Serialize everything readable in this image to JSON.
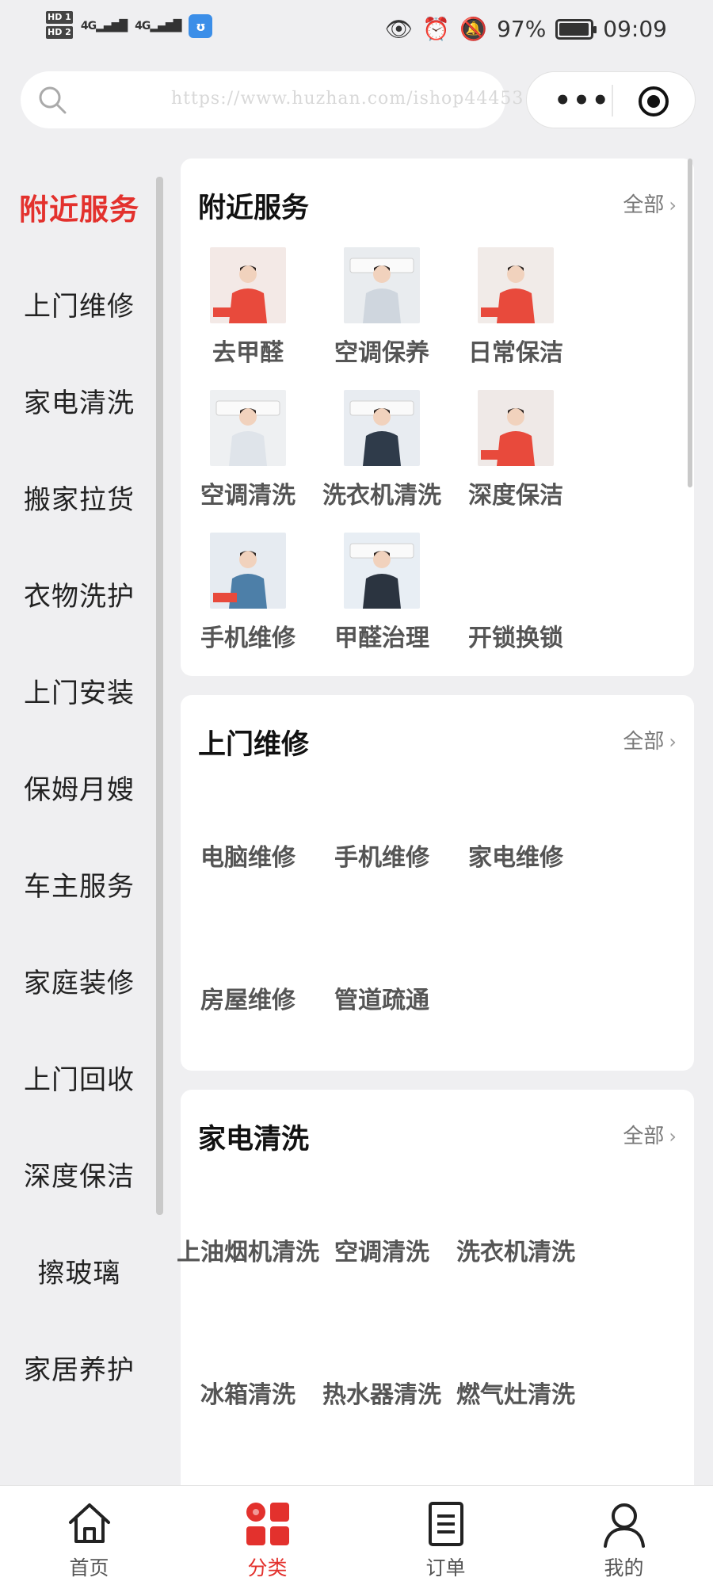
{
  "status_bar": {
    "hd1": "HD 1",
    "hd2": "HD 2",
    "sig1": "4G",
    "sig2": "4G",
    "battery": "97%",
    "time": "09:09",
    "battery_level": 0.97
  },
  "search": {
    "watermark": "https://www.huzhan.com/ishop44453"
  },
  "capsule": {
    "more_icon": "ellipsis-icon",
    "close_icon": "target-icon"
  },
  "sidebar": {
    "items": [
      {
        "label": "附近服务",
        "active": true
      },
      {
        "label": "上门维修",
        "active": false
      },
      {
        "label": "家电清洗",
        "active": false
      },
      {
        "label": "搬家拉货",
        "active": false
      },
      {
        "label": "衣物洗护",
        "active": false
      },
      {
        "label": "上门安装",
        "active": false
      },
      {
        "label": "保姆月嫂",
        "active": false
      },
      {
        "label": "车主服务",
        "active": false
      },
      {
        "label": "家庭装修",
        "active": false
      },
      {
        "label": "上门回收",
        "active": false
      },
      {
        "label": "深度保洁",
        "active": false
      },
      {
        "label": "擦玻璃",
        "active": false
      },
      {
        "label": "家居养护",
        "active": false
      }
    ]
  },
  "sections": [
    {
      "title": "附近服务",
      "all_label": "全部",
      "services": [
        "去甲醛",
        "空调保养",
        "日常保洁",
        "空调清洗",
        "洗衣机清洗",
        "深度保洁",
        "手机维修",
        "甲醛治理",
        "开锁换锁"
      ]
    },
    {
      "title": "上门维修",
      "all_label": "全部",
      "services": [
        "电脑维修",
        "手机维修",
        "家电维修",
        "房屋维修",
        "管道疏通"
      ]
    },
    {
      "title": "家电清洗",
      "all_label": "全部",
      "services": [
        "上油烟机清洗",
        "空调清洗",
        "洗衣机清洗",
        "冰箱清洗",
        "热水器清洗",
        "燃气灶清洗"
      ]
    }
  ],
  "tabbar": {
    "items": [
      {
        "label": "首页",
        "icon": "home-icon"
      },
      {
        "label": "分类",
        "icon": "category-icon"
      },
      {
        "label": "订单",
        "icon": "order-icon"
      },
      {
        "label": "我的",
        "icon": "profile-icon"
      }
    ],
    "active_color": "#e3312d"
  },
  "colors": {
    "accent": "#e3312d",
    "background": "#efeff1"
  }
}
